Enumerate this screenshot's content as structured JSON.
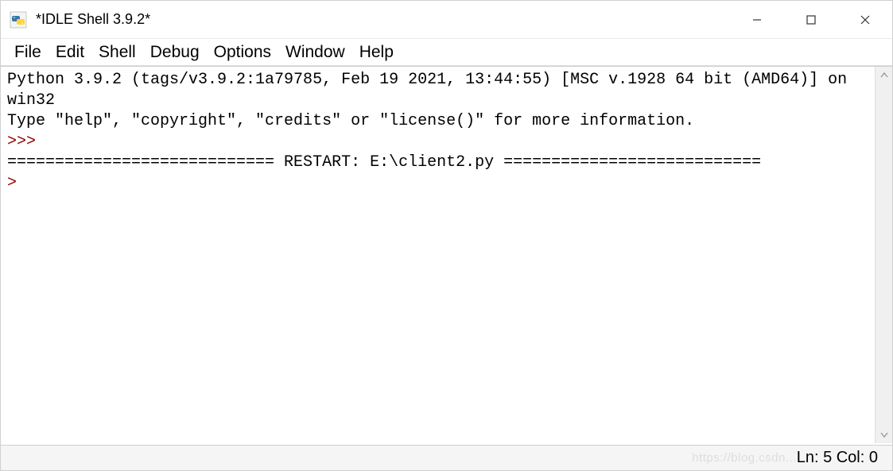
{
  "window": {
    "title": "*IDLE Shell 3.9.2*"
  },
  "menu": {
    "items": [
      "File",
      "Edit",
      "Shell",
      "Debug",
      "Options",
      "Window",
      "Help"
    ]
  },
  "shell": {
    "banner_line1": "Python 3.9.2 (tags/v3.9.2:1a79785, Feb 19 2021, 13:44:55) [MSC v.1928 64 bit (AMD64)] on win32",
    "banner_line2": "Type \"help\", \"copyright\", \"credits\" or \"license()\" for more information.",
    "prompt1": ">>> ",
    "restart_line": "============================ RESTART: E:\\client2.py ===========================",
    "prompt2": ">"
  },
  "status": {
    "position": "Ln: 5  Col: 0"
  },
  "watermark": {
    "text": "https://blog.csdn..."
  }
}
